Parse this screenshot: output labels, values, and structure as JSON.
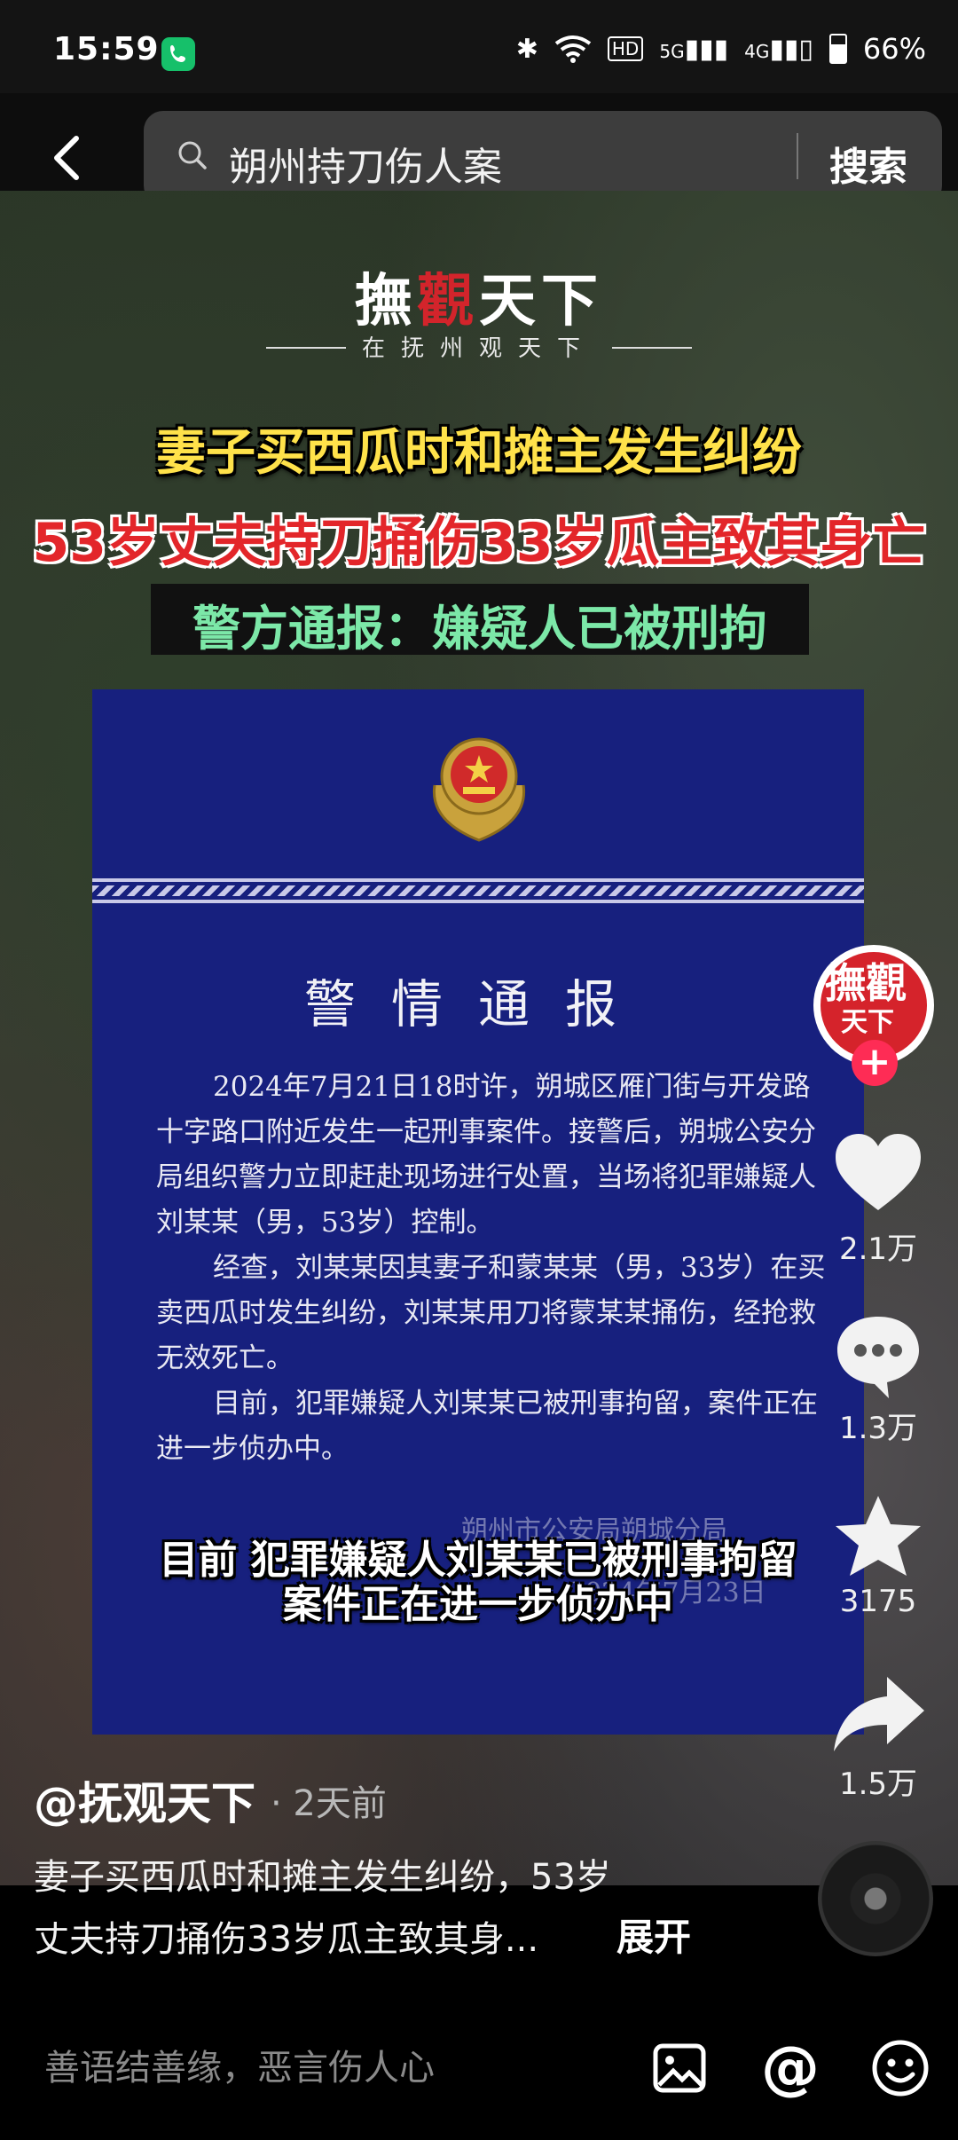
{
  "status_bar": {
    "time": "15:59",
    "hd_label": "HD",
    "signal_1": "5G",
    "signal_2": "4G",
    "battery": "66%"
  },
  "search": {
    "query": "朔州持刀伤人案",
    "button_label": "搜索"
  },
  "video": {
    "logo_title_part1": "撫",
    "logo_title_part2": "觀",
    "logo_title_part3": "天下",
    "logo_subtitle": "在抚州观天下",
    "headline_1": "妻子买西瓜时和摊主发生纠纷",
    "headline_2": "53岁丈夫持刀捅伤33岁瓜主致其身亡",
    "headline_3": "警方通报：嫌疑人已被刑拘",
    "notice": {
      "title": "警情通报",
      "paragraph_1": "2024年7月21日18时许，朔城区雁门街与开发路十字路口附近发生一起刑事案件。接警后，朔城公安分局组织警力立即赶赴现场进行处置，当场将犯罪嫌疑人刘某某（男，53岁）控制。",
      "paragraph_2": "经查，刘某某因其妻子和蒙某某（男，33岁）在买卖西瓜时发生纠纷，刘某某用刀将蒙某某捅伤，经抢救无效死亡。",
      "paragraph_3": "目前，犯罪嫌疑人刘某某已被刑事拘留，案件正在进一步侦办中。",
      "signature": "朔州市公安局朔城分局",
      "date": "2024年7月23日"
    },
    "subtitle_line_1": "目前 犯罪嫌疑人刘某某已被刑事拘留",
    "subtitle_line_2": "案件正在进一步侦办中"
  },
  "rail": {
    "avatar_text_1": "撫觀",
    "avatar_text_2": "天下",
    "follow_symbol": "+",
    "like_count": "2.1万",
    "comment_count": "1.3万",
    "favorite_count": "3175",
    "share_count": "1.5万"
  },
  "caption": {
    "author": "@抚观天下",
    "time": "· 2天前",
    "line_1": "妻子买西瓜时和摊主发生纠纷，53岁",
    "line_2": "丈夫持刀捅伤33岁瓜主致其身...",
    "expand": "展开"
  },
  "comment_bar": {
    "placeholder": "善语结善缘，恶言伤人心",
    "at_symbol": "@"
  },
  "colors": {
    "accent_red": "#fe2c55",
    "notice_blue": "#17207e",
    "headline_yellow": "#ffe24a",
    "headline_green": "#7ce8a8"
  }
}
